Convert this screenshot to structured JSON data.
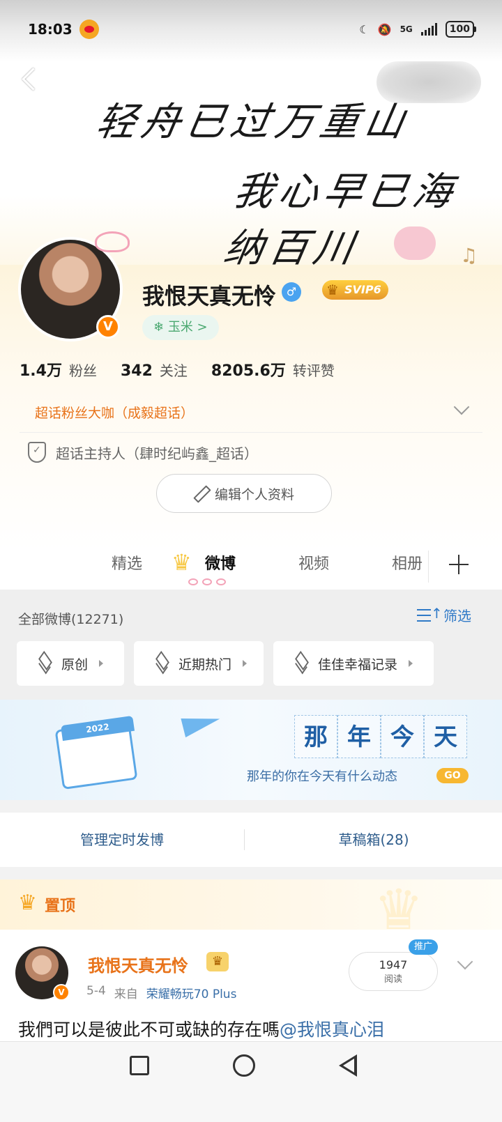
{
  "status_bar": {
    "time": "18:03",
    "network": "5G",
    "battery": "100"
  },
  "banner": {
    "line1": "轻舟已过万重山",
    "line2": "我心早已海纳百川"
  },
  "profile": {
    "username": "我恨天真无怜",
    "gender_icon": "male-icon",
    "svip_label": "SVIP6",
    "verified_badge": "V",
    "tag_label": "玉米 >",
    "stats": [
      {
        "num": "1.4万",
        "label": "粉丝"
      },
      {
        "num": "342",
        "label": "关注"
      },
      {
        "num": "8205.6万",
        "label": "转评赞"
      }
    ],
    "fan_title": "超话粉丝大咖（成毅超话）",
    "host_text": "超话主持人（肆时纪屿鑫_超话）",
    "edit_label": "编辑个人资料"
  },
  "tabs": [
    {
      "label": "精选"
    },
    {
      "label": "微博"
    },
    {
      "label": "视频"
    },
    {
      "label": "相册"
    }
  ],
  "feed": {
    "all_count": "全部微博(12271)",
    "filter_label": "筛选",
    "chips": [
      {
        "label": "原创"
      },
      {
        "label": "近期热门"
      },
      {
        "label": "佳佳幸福记录"
      }
    ]
  },
  "memory": {
    "calendar_year": "2022",
    "title_chars": [
      "那",
      "年",
      "今",
      "天"
    ],
    "subtitle": "那年的你在今天有什么动态",
    "go_label": "GO"
  },
  "manage": {
    "scheduled": "管理定时发博",
    "drafts": "草稿箱(28)"
  },
  "pinned_post": {
    "pin_label": "置顶",
    "author": "我恨天真无怜",
    "date": "5-4",
    "from_label": "来自",
    "source": "荣耀畅玩70 Plus",
    "read_count": "1947",
    "read_label": "阅读",
    "promo_label": "推广",
    "text": "我們可以是彼此不可或缺的存在嗎",
    "mention": "@我恨真心泪"
  },
  "colors": {
    "accent_orange": "#e8731a",
    "link_blue": "#2f79c7",
    "svip_gold": "#e6972a"
  }
}
